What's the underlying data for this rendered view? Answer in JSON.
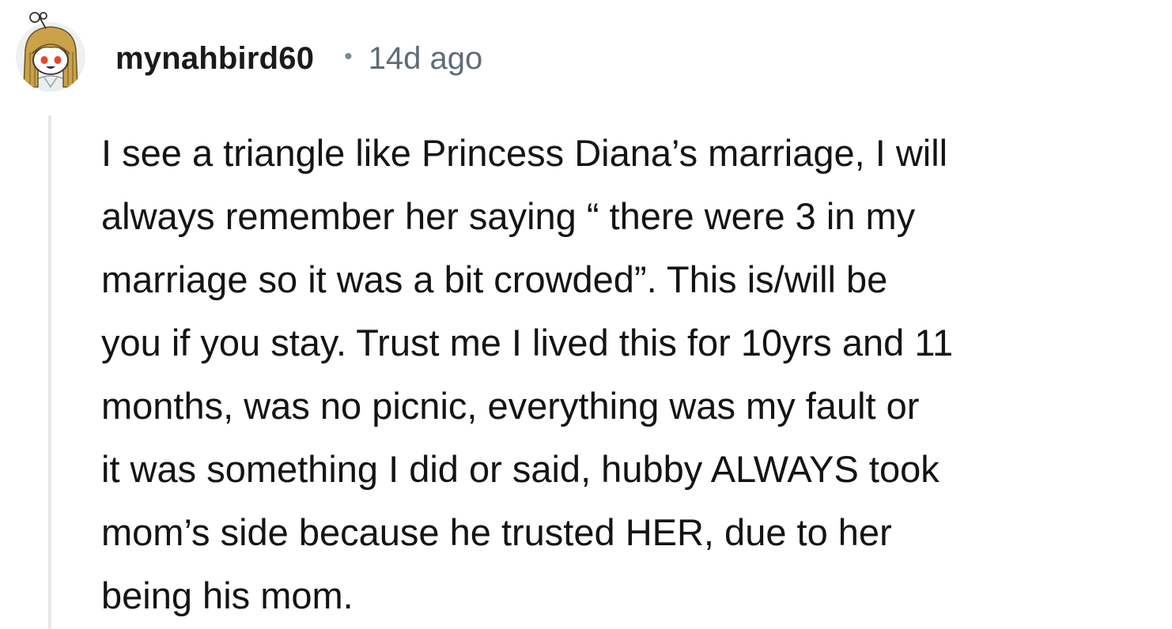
{
  "comment": {
    "author": "mynahbird60",
    "separator": "•",
    "timestamp": "14d ago",
    "avatar_icon": "snoo-avatar-icon",
    "body_lines": [
      "I see a triangle like Princess Diana’s marriage, I will",
      "always remember her saying “ there were 3 in my",
      "marriage so it was a bit crowded”. This is/will be",
      "you if you stay. Trust me I lived this for 10yrs and 11",
      "months, was no picnic, everything was my fault or",
      "it was something I did or said, hubby ALWAYS took",
      "mom’s side because he trusted HER, due to her",
      "being his mom."
    ]
  },
  "colors": {
    "username": "#1a1a1b",
    "timestamp": "#5f6c77",
    "body": "#141414",
    "thread_line": "#e6e8ea",
    "avatar_hair": "#c9a24a",
    "avatar_face": "#ffffff",
    "avatar_eyes": "#e8462c"
  }
}
